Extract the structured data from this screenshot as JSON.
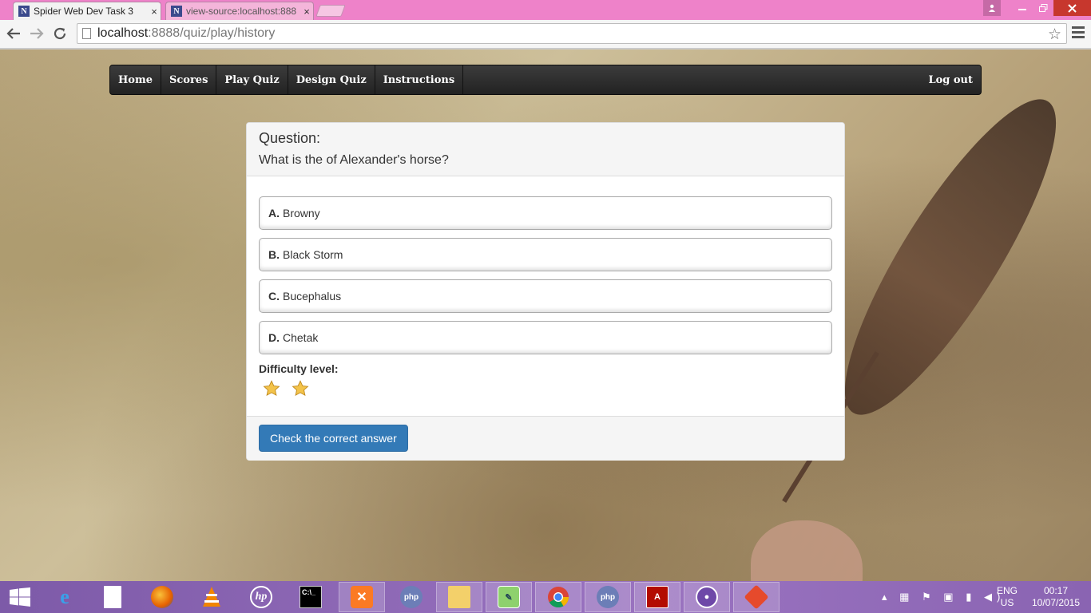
{
  "browser": {
    "tabs": [
      {
        "favicon": "N",
        "title": "Spider Web Dev Task 3",
        "close": "×"
      },
      {
        "favicon": "N",
        "title": "view-source:localhost:888",
        "close": "×"
      }
    ],
    "url_host": "localhost",
    "url_path": ":8888/quiz/play/history"
  },
  "nav": {
    "items": [
      "Home",
      "Scores",
      "Play Quiz",
      "Design Quiz",
      "Instructions"
    ],
    "logout": "Log out"
  },
  "quiz": {
    "question_label": "Question:",
    "question_text": "What is the of Alexander's horse?",
    "options": [
      {
        "letter": "A.",
        "text": "Browny"
      },
      {
        "letter": "B.",
        "text": "Black Storm"
      },
      {
        "letter": "C.",
        "text": "Bucephalus"
      },
      {
        "letter": "D.",
        "text": "Chetak"
      }
    ],
    "difficulty_label": "Difficulty level:",
    "difficulty_stars": 2,
    "check_button": "Check the correct answer"
  },
  "taskbar": {
    "language": "ENG",
    "region": "US",
    "time": "00:17",
    "date": "10/07/2015",
    "apps": [
      "start-icon",
      "ie-icon",
      "file-icon",
      "firefox-icon",
      "vlc-icon",
      "hp-icon",
      "cmd-icon",
      "xampp-icon",
      "php-icon",
      "explorer-icon",
      "notepadpp-icon",
      "chrome-icon",
      "phpstorm-icon",
      "acrobat-icon",
      "github-icon",
      "git-icon"
    ]
  },
  "colors": {
    "tabstrip": "#ee82c9",
    "navbar": "#222222",
    "primary": "#337ab7",
    "star": "#f3c34a"
  }
}
